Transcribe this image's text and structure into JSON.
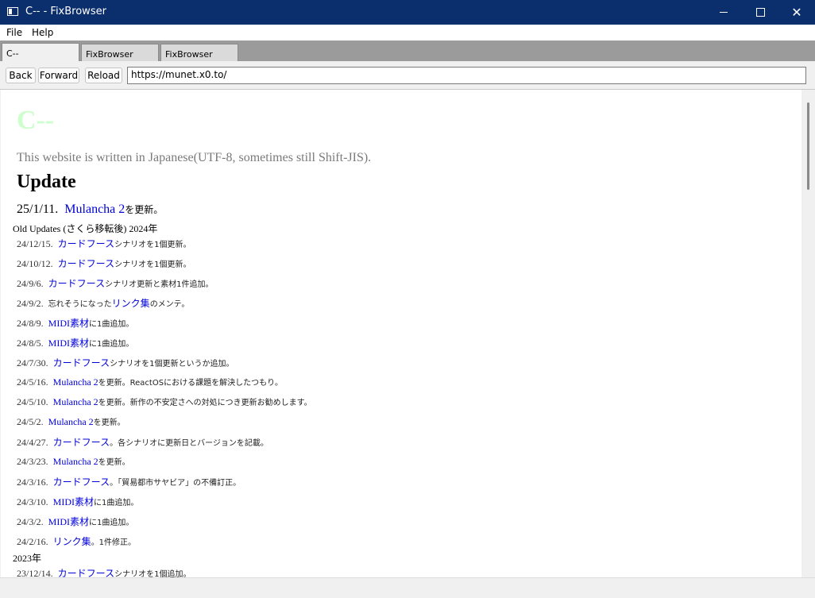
{
  "window": {
    "title": "C-- - FixBrowser"
  },
  "menu": {
    "file": "File",
    "help": "Help"
  },
  "tabs": [
    "C--",
    "FixBrowser",
    "FixBrowser"
  ],
  "nav": {
    "back": "Back",
    "forward": "Forward",
    "reload": "Reload",
    "url": "https://munet.x0.to/"
  },
  "page": {
    "title": "C--",
    "notice": "This website is written in Japanese(UTF-8, sometimes still Shift-JIS).",
    "update_heading": "Update",
    "latest": {
      "date": "25/1/11.",
      "link": "Mulancha 2",
      "text": "を更新。"
    },
    "old_updates_label": "Old Updates (さくら移転後) 2024年",
    "year_2023_label": "2023年",
    "entries_2024": [
      {
        "date": "24/12/15.",
        "link": "カードフース",
        "text": "シナリオを1個更新。"
      },
      {
        "date": "24/10/12.",
        "link": "カードフース",
        "text": "シナリオを1個更新。"
      },
      {
        "date": "24/9/6.",
        "link": "カードフース",
        "text": "シナリオ更新と素材1件追加。"
      },
      {
        "date": "24/9/2.",
        "pre": "忘れそうになった",
        "link": "リンク集",
        "text": "のメンテ。"
      },
      {
        "date": "24/8/9.",
        "link": "MIDI素材",
        "text": "に1曲追加。"
      },
      {
        "date": "24/8/5.",
        "link": "MIDI素材",
        "text": "に1曲追加。"
      },
      {
        "date": "24/7/30.",
        "link": "カードフース",
        "text": "シナリオを1個更新というか追加。"
      },
      {
        "date": "24/5/16.",
        "link": "Mulancha 2",
        "text": "を更新。ReactOSにおける課題を解決したつもり。"
      },
      {
        "date": "24/5/10.",
        "link": "Mulancha 2",
        "text": "を更新。新作の不安定さへの対処につき更新お勧めします。"
      },
      {
        "date": "24/5/2.",
        "link": "Mulancha 2",
        "text": "を更新。"
      },
      {
        "date": "24/4/27.",
        "link": "カードフース",
        "text": "。各シナリオに更新日とバージョンを記載。"
      },
      {
        "date": "24/3/23.",
        "link": "Mulancha 2",
        "text": "を更新。"
      },
      {
        "date": "24/3/16.",
        "link": "カードフース",
        "text": "。「貿易都市サヤビア」の不備訂正。"
      },
      {
        "date": "24/3/10.",
        "link": "MIDI素材",
        "text": "に1曲追加。"
      },
      {
        "date": "24/3/2.",
        "link": "MIDI素材",
        "text": "に1曲追加。"
      },
      {
        "date": "24/2/16.",
        "link": "リンク集",
        "text": "。1件修正。"
      }
    ],
    "entries_2023": [
      {
        "date": "23/12/14.",
        "link": "カードフース",
        "text": "シナリオを1個追加。"
      }
    ]
  }
}
